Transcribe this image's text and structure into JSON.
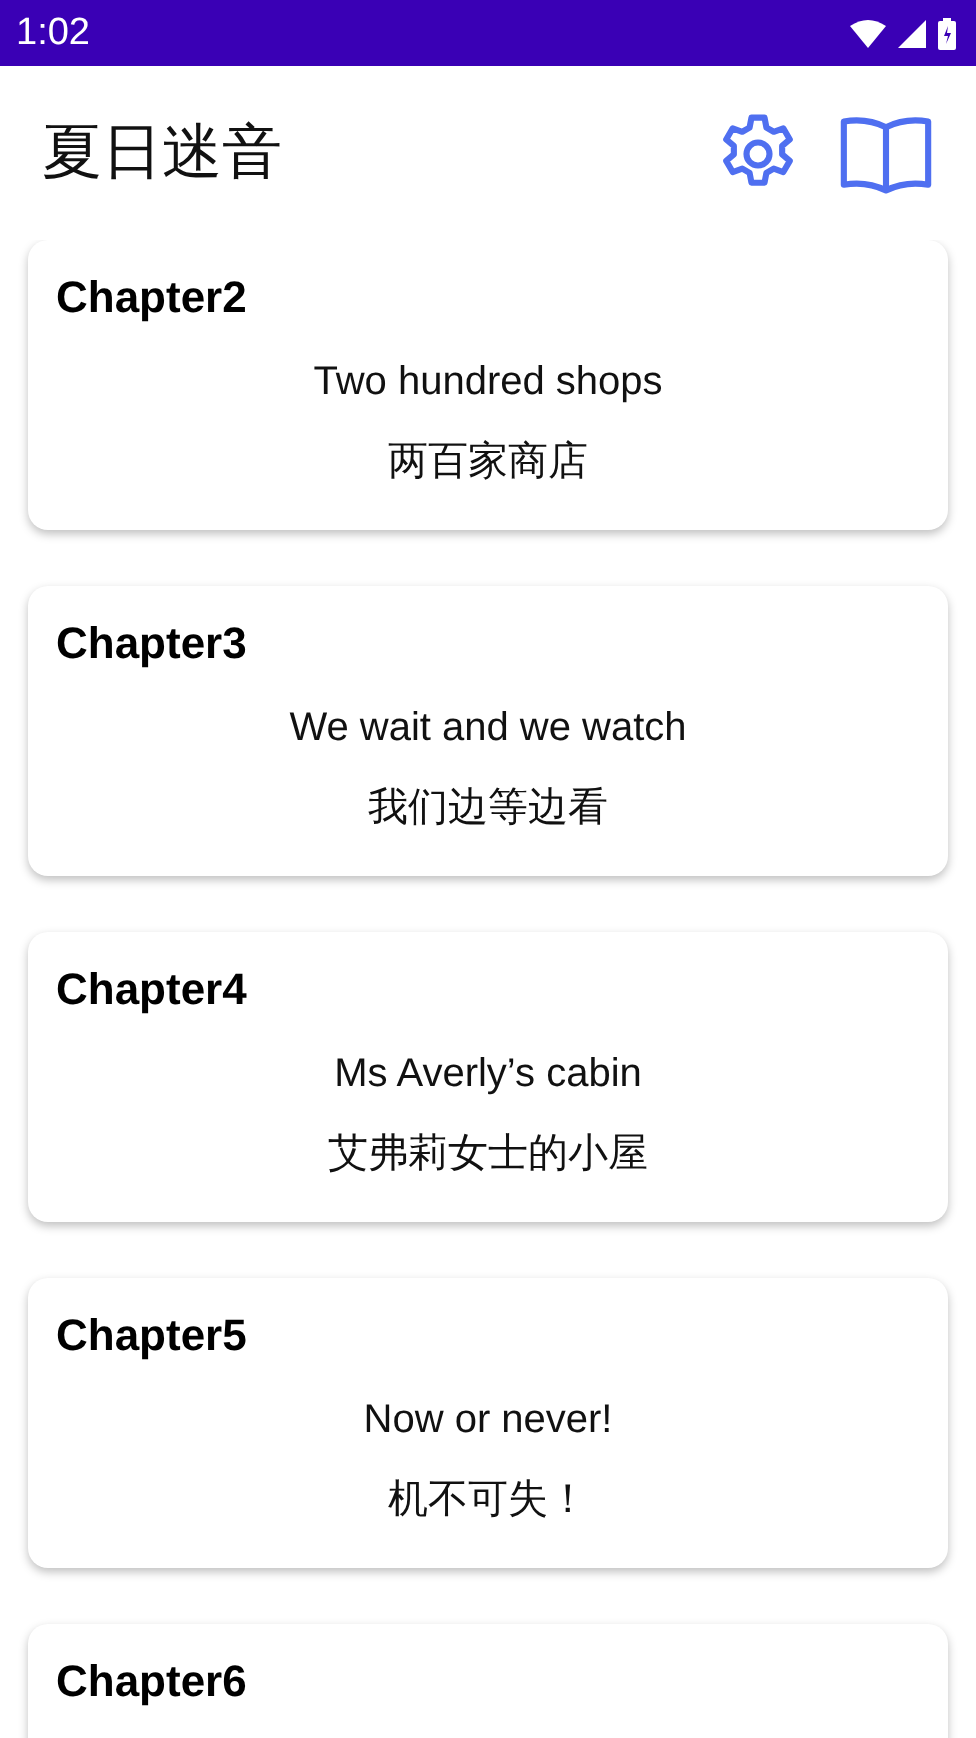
{
  "status_bar": {
    "time": "1:02"
  },
  "app_bar": {
    "title": "夏日迷音"
  },
  "chapters": [
    {
      "title": "Chapter2",
      "english": "Two hundred shops",
      "chinese": "两百家商店"
    },
    {
      "title": "Chapter3",
      "english": "We wait and we watch",
      "chinese": "我们边等边看"
    },
    {
      "title": "Chapter4",
      "english": "Ms Averly’s cabin",
      "chinese": "艾弗莉女士的小屋"
    },
    {
      "title": "Chapter5",
      "english": "Now or never!",
      "chinese": "机不可失！"
    },
    {
      "title": "Chapter6"
    }
  ]
}
